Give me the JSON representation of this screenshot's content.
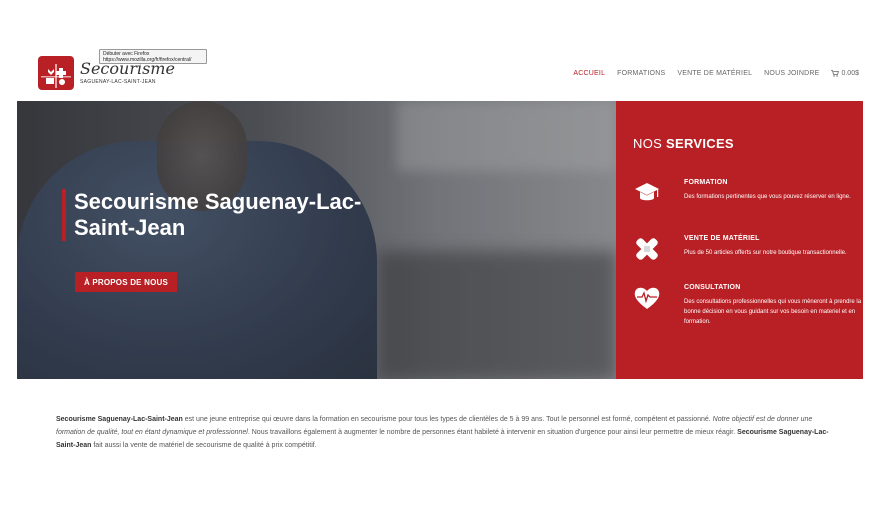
{
  "tooltip": {
    "line1": "Débuter avec Firefox",
    "line2": "https://www.mozilla.org/fr/firefox/central/"
  },
  "logo": {
    "name": "Secourisme",
    "tagline": "SAGUENAY-LAC-SAINT-JEAN"
  },
  "nav": {
    "items": [
      "ACCUEIL",
      "FORMATIONS",
      "VENTE DE MATÉRIEL",
      "NOUS JOINDRE"
    ],
    "cart_total": "0.00$",
    "accent": "#b92025"
  },
  "hero": {
    "title": "Secourisme Saguenay-Lac-Saint-Jean",
    "button_label": "À PROPOS DE NOUS"
  },
  "services": {
    "heading_prefix": "NOS",
    "heading_bold": "SERVICES",
    "items": [
      {
        "icon": "graduation-cap-icon",
        "title": "FORMATION",
        "desc": "Des formations pertinentes que vous pouvez réserver en ligne."
      },
      {
        "icon": "bandage-icon",
        "title": "VENTE DE MATÉRIEL",
        "desc": "Plus de 50 articles offerts sur notre boutique transactionnelle."
      },
      {
        "icon": "heart-pulse-icon",
        "title": "CONSULTATION",
        "desc": "Des consultations professionnelles qui vous mèneront à prendre la bonne décision en vous guidant sur vos besoin en materiel et en formation."
      }
    ]
  },
  "intro": {
    "company": "Secourisme Saguenay-Lac-Saint-Jean",
    "part1": " est une jeune entreprise qui œuvre dans la formation en secourisme pour tous les types de clientèles de 5 à 99 ans. Tout le personnel est formé, compétent et passionné. ",
    "italic": "Notre objectif est de donner une formation de qualité, tout en étant dynamique et professionnel",
    "part2": ". Nous travaillons également  à augmenter le nombre de personnes étant habileté à intervenir en situation d'urgence pour ainsi leur permettre de mieux réagir. ",
    "company2": "Secourisme Saguenay-Lac-Saint-Jean",
    "part3": " fait aussi la vente de matériel de secourisme de qualité à prix compétitif."
  }
}
